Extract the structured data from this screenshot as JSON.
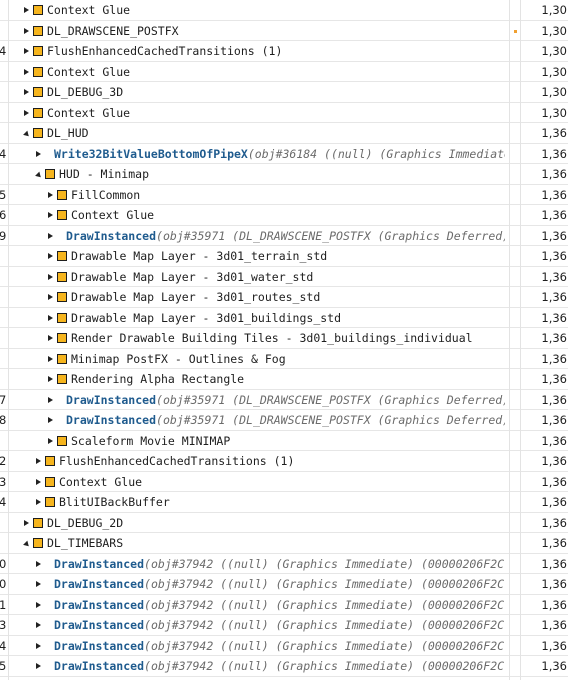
{
  "rows": [
    {
      "num": "",
      "kind": "group",
      "expander": "collapsed",
      "depth": 0,
      "label": "Context Glue",
      "value": "1,30"
    },
    {
      "num": "",
      "kind": "group",
      "expander": "collapsed",
      "depth": 0,
      "label": "DL_DRAWSCENE_POSTFX",
      "value": "1,30",
      "marker": true
    },
    {
      "num": "4",
      "kind": "group",
      "expander": "collapsed",
      "depth": 0,
      "label": "FlushEnhancedCachedTransitions (1)",
      "value": "1,30"
    },
    {
      "num": "",
      "kind": "group",
      "expander": "collapsed",
      "depth": 0,
      "label": "Context Glue",
      "value": "1,30"
    },
    {
      "num": "",
      "kind": "group",
      "expander": "collapsed",
      "depth": 0,
      "label": "DL_DEBUG_3D",
      "value": "1,30"
    },
    {
      "num": "",
      "kind": "group",
      "expander": "collapsed",
      "depth": 0,
      "label": "Context Glue",
      "value": "1,30"
    },
    {
      "num": "",
      "kind": "group",
      "expander": "expanded",
      "depth": 0,
      "label": "DL_HUD",
      "value": "1,36"
    },
    {
      "num": "4",
      "kind": "call",
      "expander": "collapsed",
      "depth": 1,
      "call": "Write32BitValueBottomOfPipeX",
      "args": "(obj#36184 ((null) (Graphics Immediate...",
      "value": "1,36"
    },
    {
      "num": "",
      "kind": "group",
      "expander": "expanded",
      "depth": 1,
      "label": "HUD - Minimap",
      "value": "1,36"
    },
    {
      "num": "5",
      "kind": "group",
      "expander": "collapsed",
      "depth": 2,
      "label": "FillCommon",
      "value": "1,36"
    },
    {
      "num": "6",
      "kind": "group",
      "expander": "collapsed",
      "depth": 2,
      "label": "Context Glue",
      "value": "1,36"
    },
    {
      "num": "9",
      "kind": "call",
      "expander": "collapsed",
      "depth": 2,
      "call": "DrawInstanced",
      "args": "(obj#35971 (DL_DRAWSCENE_POSTFX (Graphics Deferred)...",
      "value": "1,36"
    },
    {
      "num": "",
      "kind": "group",
      "expander": "collapsed",
      "depth": 2,
      "label": "Drawable Map Layer - 3d01_terrain_std",
      "value": "1,36"
    },
    {
      "num": "",
      "kind": "group",
      "expander": "collapsed",
      "depth": 2,
      "label": "Drawable Map Layer - 3d01_water_std",
      "value": "1,36"
    },
    {
      "num": "",
      "kind": "group",
      "expander": "collapsed",
      "depth": 2,
      "label": "Drawable Map Layer - 3d01_routes_std",
      "value": "1,36"
    },
    {
      "num": "",
      "kind": "group",
      "expander": "collapsed",
      "depth": 2,
      "label": "Drawable Map Layer - 3d01_buildings_std",
      "value": "1,36"
    },
    {
      "num": "",
      "kind": "group",
      "expander": "collapsed",
      "depth": 2,
      "label": "Render Drawable Building Tiles - 3d01_buildings_individual",
      "value": "1,36"
    },
    {
      "num": "",
      "kind": "group",
      "expander": "collapsed",
      "depth": 2,
      "label": "Minimap PostFX - Outlines & Fog",
      "value": "1,36"
    },
    {
      "num": "",
      "kind": "group",
      "expander": "collapsed",
      "depth": 2,
      "label": "Rendering Alpha Rectangle",
      "value": "1,36"
    },
    {
      "num": "7",
      "kind": "call",
      "expander": "collapsed",
      "depth": 2,
      "call": "DrawInstanced",
      "args": "(obj#35971 (DL_DRAWSCENE_POSTFX (Graphics Deferred)...",
      "value": "1,36"
    },
    {
      "num": "8",
      "kind": "call",
      "expander": "collapsed",
      "depth": 2,
      "call": "DrawInstanced",
      "args": "(obj#35971 (DL_DRAWSCENE_POSTFX (Graphics Deferred)...",
      "value": "1,36"
    },
    {
      "num": "",
      "kind": "group",
      "expander": "collapsed",
      "depth": 2,
      "label": "Scaleform Movie MINIMAP",
      "value": "1,36"
    },
    {
      "num": "2",
      "kind": "group",
      "expander": "collapsed",
      "depth": 1,
      "label": "FlushEnhancedCachedTransitions (1)",
      "value": "1,36"
    },
    {
      "num": "3",
      "kind": "group",
      "expander": "collapsed",
      "depth": 1,
      "label": "Context Glue",
      "value": "1,36"
    },
    {
      "num": "4",
      "kind": "group",
      "expander": "collapsed",
      "depth": 1,
      "label": "BlitUIBackBuffer",
      "value": "1,36"
    },
    {
      "num": "",
      "kind": "group",
      "expander": "collapsed",
      "depth": 0,
      "label": "DL_DEBUG_2D",
      "value": "1,36"
    },
    {
      "num": "",
      "kind": "group",
      "expander": "expanded",
      "depth": 0,
      "label": "DL_TIMEBARS",
      "value": "1,36"
    },
    {
      "num": "0",
      "kind": "call",
      "expander": "collapsed",
      "depth": 1,
      "call": "DrawInstanced",
      "args": "(obj#37942 ((null) (Graphics Immediate) (00000206F2C7...",
      "value": "1,36"
    },
    {
      "num": "0",
      "kind": "call",
      "expander": "collapsed",
      "depth": 1,
      "call": "DrawInstanced",
      "args": "(obj#37942 ((null) (Graphics Immediate) (00000206F2C7...",
      "value": "1,36"
    },
    {
      "num": "1",
      "kind": "call",
      "expander": "collapsed",
      "depth": 1,
      "call": "DrawInstanced",
      "args": "(obj#37942 ((null) (Graphics Immediate) (00000206F2C7...",
      "value": "1,36"
    },
    {
      "num": "3",
      "kind": "call",
      "expander": "collapsed",
      "depth": 1,
      "call": "DrawInstanced",
      "args": "(obj#37942 ((null) (Graphics Immediate) (00000206F2C7...",
      "value": "1,36"
    },
    {
      "num": "4",
      "kind": "call",
      "expander": "collapsed",
      "depth": 1,
      "call": "DrawInstanced",
      "args": "(obj#37942 ((null) (Graphics Immediate) (00000206F2C7...",
      "value": "1,36"
    },
    {
      "num": "5",
      "kind": "call",
      "expander": "collapsed",
      "depth": 1,
      "call": "DrawInstanced",
      "args": "(obj#37942 ((null) (Graphics Immediate) (00000206F2C7...",
      "value": "1,36"
    }
  ]
}
